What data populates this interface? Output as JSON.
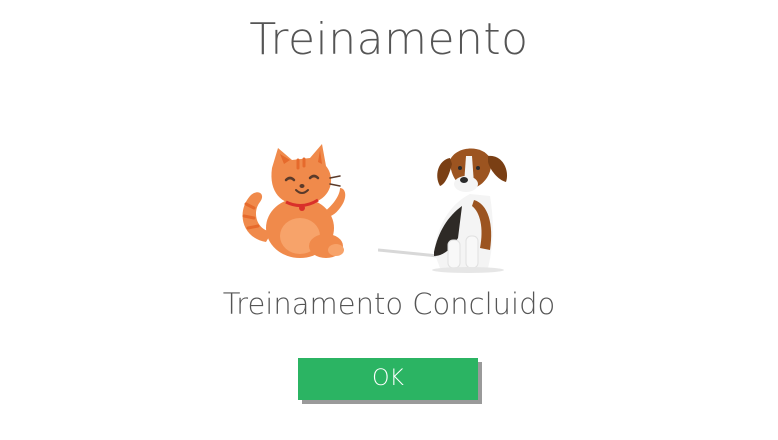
{
  "screen": {
    "title": "Treinamento",
    "message": "Treinamento Concluido",
    "illustration": {
      "cat_icon": "cat-icon",
      "dog_icon": "dog-icon"
    },
    "ok_button": {
      "label": "OK",
      "color": "#2bb463"
    }
  }
}
